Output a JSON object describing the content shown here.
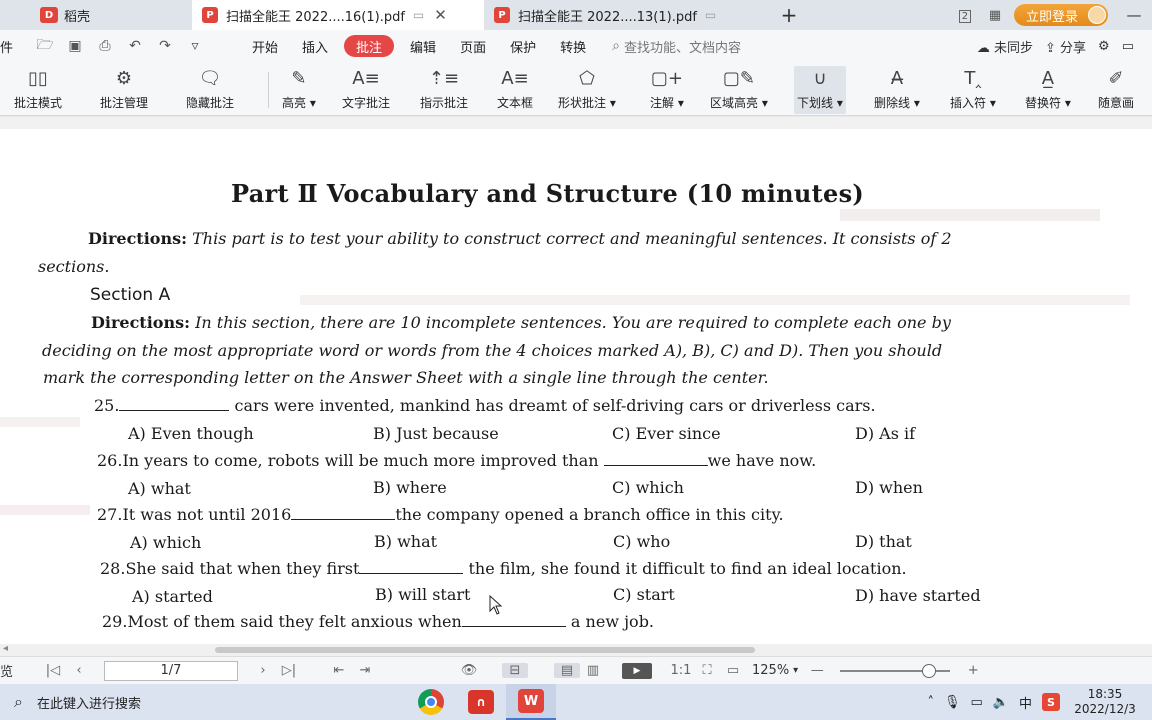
{
  "tabs": {
    "home_label": "稻壳",
    "active_label": "扫描全能王 2022....16(1).pdf",
    "other_label": "扫描全能王 2022....13(1).pdf",
    "new_tab": "+"
  },
  "top_right": {
    "login_label": "立即登录",
    "page_count_badge": "2"
  },
  "menu": {
    "lead": "件",
    "items": [
      "开始",
      "插入",
      "批注",
      "编辑",
      "页面",
      "保护",
      "转换"
    ],
    "active": "批注",
    "search_placeholder": "查找功能、文档内容",
    "sync": "未同步",
    "share": "分享"
  },
  "ribbon": [
    {
      "label": "批注模式",
      "icon": "annotation-mode-icon"
    },
    {
      "label": "批注管理",
      "icon": "annotation-manage-icon"
    },
    {
      "label": "隐藏批注",
      "icon": "hide-annotation-icon"
    },
    {
      "label": "高亮 ▾",
      "icon": "highlight-icon"
    },
    {
      "label": "文字批注",
      "icon": "text-annotation-icon"
    },
    {
      "label": "指示批注",
      "icon": "pointer-annotation-icon"
    },
    {
      "label": "文本框",
      "icon": "textbox-icon"
    },
    {
      "label": "形状批注 ▾",
      "icon": "shape-annotation-icon"
    },
    {
      "label": "注解 ▾",
      "icon": "note-icon"
    },
    {
      "label": "区域高亮 ▾",
      "icon": "area-highlight-icon"
    },
    {
      "label": "下划线 ▾",
      "icon": "underline-icon"
    },
    {
      "label": "删除线 ▾",
      "icon": "strikethrough-icon"
    },
    {
      "label": "插入符 ▾",
      "icon": "insert-caret-icon"
    },
    {
      "label": "替换符 ▾",
      "icon": "replace-icon"
    },
    {
      "label": "随意画",
      "icon": "freehand-icon"
    }
  ],
  "document": {
    "title": "Part Ⅱ    Vocabulary and Structure (10 minutes)",
    "directions1_label": "Directions:",
    "directions1_line1": "This part is to test your ability to construct correct and meaningful sentences. It consists of 2",
    "directions1_line2": "sections.",
    "section_a": "Section A",
    "directions2_label": "Directions:",
    "directions2_line1": "In this section, there are 10 incomplete sentences. You are required to complete each one by",
    "directions2_line2": "deciding on the most appropriate word or words from the 4 choices marked A), B), C) and D). Then you should",
    "directions2_line3": "mark the corresponding letter on the Answer Sheet with a single line through the center.",
    "questions": [
      {
        "pre": "25.",
        "post": " cars were invented, mankind has dreamt of self-driving cars or driverless cars.",
        "options": [
          "A) Even though",
          "B) Just because",
          "C) Ever since",
          "D) As if"
        ]
      },
      {
        "pre": "26.In years to come, robots will be much more improved than ",
        "post": "we have now.",
        "options": [
          "A) what",
          "B) where",
          "C) which",
          "D) when"
        ]
      },
      {
        "pre": "27.It was not until 2016",
        "post": "the company opened a branch office in this city.",
        "options": [
          "A) which",
          "B) what",
          "C) who",
          "D) that"
        ]
      },
      {
        "pre": "28.She said that when they first",
        "post": " the film, she found it difficult to find an ideal location.",
        "options": [
          "A) started",
          "B) will start",
          "C) start",
          "D) have started"
        ]
      },
      {
        "pre": "29.Most of them said they felt anxious when",
        "post": " a new job.",
        "options": []
      }
    ]
  },
  "status": {
    "lead": "览",
    "page": "1/7",
    "zoom": "125%"
  },
  "taskbar": {
    "search_placeholder": "在此键入进行搜索",
    "time": "18:35",
    "date": "2022/12/3",
    "ime": "中"
  }
}
